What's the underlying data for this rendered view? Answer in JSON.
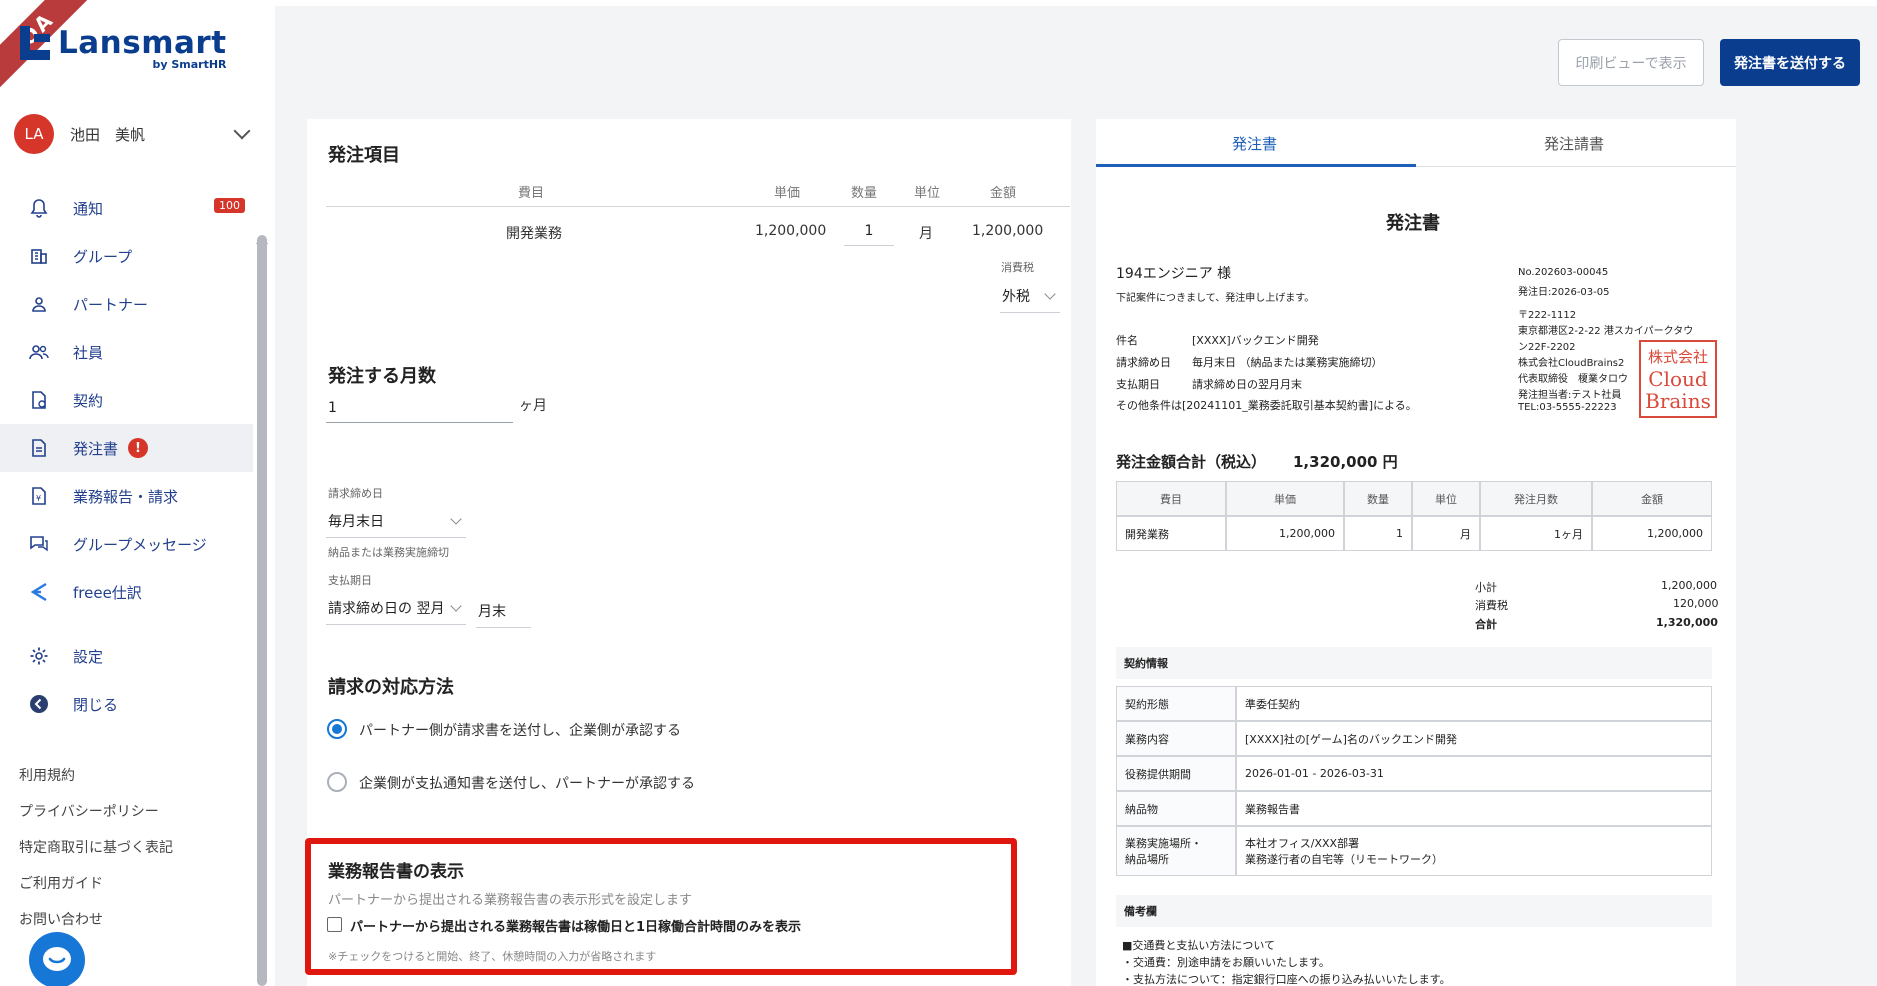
{
  "app": {
    "name": "Lansmart",
    "by": "by SmartHR",
    "env_ribbon": "QA"
  },
  "user": {
    "initials": "LA",
    "name": "池田　美帆"
  },
  "nav": {
    "items": [
      {
        "label": "通知",
        "icon": "bell-icon",
        "badge": "100"
      },
      {
        "label": "グループ",
        "icon": "building-icon"
      },
      {
        "label": "パートナー",
        "icon": "person-icon"
      },
      {
        "label": "社員",
        "icon": "people-icon"
      },
      {
        "label": "契約",
        "icon": "contract-icon"
      },
      {
        "label": "発注書",
        "icon": "document-icon",
        "info": "!"
      },
      {
        "label": "業務報告・請求",
        "icon": "report-icon"
      },
      {
        "label": "グループメッセージ",
        "icon": "message-icon"
      },
      {
        "label": "freee仕訳",
        "icon": "freee-icon"
      }
    ],
    "bottom": [
      {
        "label": "設定",
        "icon": "gear-icon"
      },
      {
        "label": "閉じる",
        "icon": "close-arrow-icon"
      }
    ]
  },
  "footer_links": [
    "利用規約",
    "プライバシーポリシー",
    "特定商取引に基づく表記",
    "ご利用ガイド",
    "お問い合わせ"
  ],
  "header": {
    "print_view": "印刷ビューで表示",
    "send": "発注書を送付する"
  },
  "form": {
    "order_items": {
      "title": "発注項目",
      "headers": {
        "item": "費目",
        "unit_price": "単価",
        "qty": "数量",
        "unit": "単位",
        "amount": "金額"
      },
      "row": {
        "item": "開発業務",
        "unit_price": "1,200,000",
        "qty": "1",
        "unit": "月",
        "amount": "1,200,000"
      },
      "tax_label": "消費税",
      "tax_value": "外税"
    },
    "months": {
      "title": "発注する月数",
      "value": "1",
      "suffix": "ヶ月"
    },
    "closing": {
      "label": "請求締め日",
      "value": "毎月末日",
      "note": "納品または業務実施締切"
    },
    "payment": {
      "label": "支払期日",
      "value": "請求締め日の 翌月",
      "day": "月末"
    },
    "billing_method": {
      "title": "請求の対応方法",
      "option1": "パートナー側が請求書を送付し、企業側が承認する",
      "option2": "企業側が支払通知書を送付し、パートナーが承認する"
    },
    "report_display": {
      "title": "業務報告書の表示",
      "desc": "パートナーから提出される業務報告書の表示形式を設定します",
      "checkbox": "パートナーから提出される業務報告書は稼働日と1日稼働合計時間のみを表示",
      "note": "※チェックをつけると開始、終了、休憩時間の入力が省略されます"
    }
  },
  "preview": {
    "tabs": [
      "発注書",
      "発注請書"
    ],
    "doc_title": "発注書",
    "to": "194エンジニア 様",
    "intro": "下記案件につきまして、発注申し上げます。",
    "fields": [
      {
        "k": "件名",
        "v": "[XXXX]バックエンド開発"
      },
      {
        "k": "請求締め日",
        "v": "毎月末日 （納品または業務実施締切）"
      },
      {
        "k": "支払期日",
        "v": "請求締め日の翌月月末"
      }
    ],
    "other_terms": "その他条件は[20241101_業務委託取引基本契約書]による。",
    "issuer": {
      "no": "No.202603-00045",
      "date": "発注日:2026-03-05",
      "zip": "〒222-1112",
      "addr1": "東京都港区2-2-22 港スカイパークタウ",
      "addr2": "ン22F-2202",
      "company": "株式会社CloudBrains2",
      "rep": "代表取締役　榎業タロウ",
      "contact": "発注担当者:テスト社員",
      "tel": "TEL:03-5555-22223"
    },
    "seal_text": [
      "株式会社",
      "Cloud",
      "Brains"
    ],
    "total_label": "発注金額合計（税込）",
    "total_value": "1,320,000 円",
    "table": {
      "headers": [
        "費目",
        "単価",
        "数量",
        "単位",
        "発注月数",
        "金額"
      ],
      "row": [
        "開発業務",
        "1,200,000",
        "1",
        "月",
        "1ヶ月",
        "1,200,000"
      ]
    },
    "summary": [
      {
        "k": "小計",
        "v": "1,200,000"
      },
      {
        "k": "消費税",
        "v": "120,000"
      },
      {
        "k": "合計",
        "v": "1,320,000"
      }
    ],
    "contract_title": "契約情報",
    "contract": [
      {
        "k": "契約形態",
        "v": "準委任契約"
      },
      {
        "k": "業務内容",
        "v": "[XXXX]社の[ゲーム]名のバックエンド開発"
      },
      {
        "k": "役務提供期間",
        "v": "2026-01-01 - 2026-03-31"
      },
      {
        "k": "納品物",
        "v": "業務報告書"
      },
      {
        "k": "業務実施場所・",
        "k2": "納品場所",
        "v": "本社オフィス/XXX部署",
        "v2": "業務遂行者の自宅等（リモートワーク）"
      }
    ],
    "notes_title": "備考欄",
    "notes": [
      "■交通費と支払い方法について",
      "・交通費：別途申請をお願いいたします。",
      "・支払方法について：指定銀行口座への振り込み払いいたします。"
    ]
  }
}
